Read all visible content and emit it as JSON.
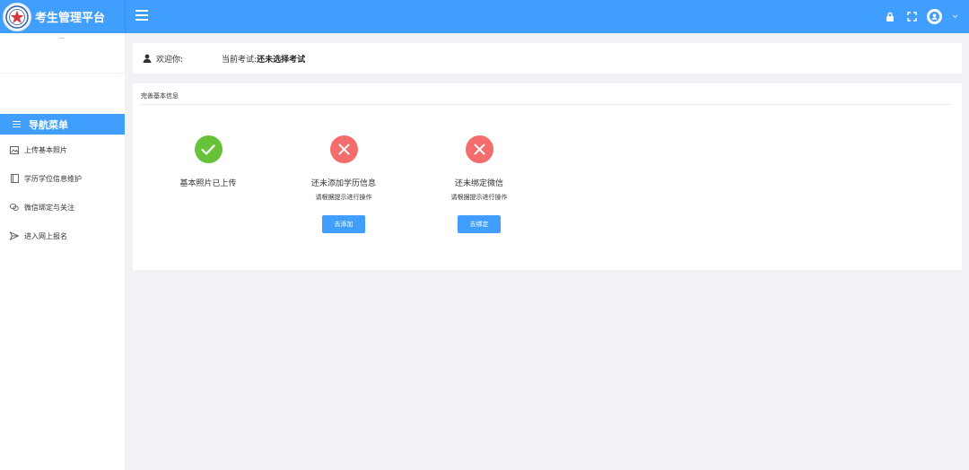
{
  "app": {
    "title": "考生管理平台"
  },
  "colors": {
    "primary": "#409eff",
    "success": "#67c23a",
    "danger": "#f56c6c"
  },
  "header": {
    "icons": [
      "menu-icon",
      "lock-icon",
      "fullscreen-icon",
      "user-avatar-icon",
      "chevron-down-icon"
    ]
  },
  "sidebar": {
    "menu_title": "导航菜单",
    "items": [
      {
        "label": "上传基本照片",
        "icon": "image-icon"
      },
      {
        "label": "学历学位信息维护",
        "icon": "book-icon"
      },
      {
        "label": "微信绑定与关注",
        "icon": "wechat-icon"
      },
      {
        "label": "进入网上报名",
        "icon": "send-icon"
      }
    ]
  },
  "welcome": {
    "greeting": "欢迎你:",
    "exam_label": "当前考试:",
    "exam_value": "还未选择考试"
  },
  "main": {
    "title": "完善基本信息",
    "steps": [
      {
        "status": "success",
        "text": "基本照片已上传",
        "hint": "",
        "button": ""
      },
      {
        "status": "error",
        "text": "还未添加学历信息",
        "hint": "请根据提示进行操作",
        "button": "去添加"
      },
      {
        "status": "error",
        "text": "还未绑定微信",
        "hint": "请根据提示进行操作",
        "button": "去绑定"
      }
    ]
  }
}
